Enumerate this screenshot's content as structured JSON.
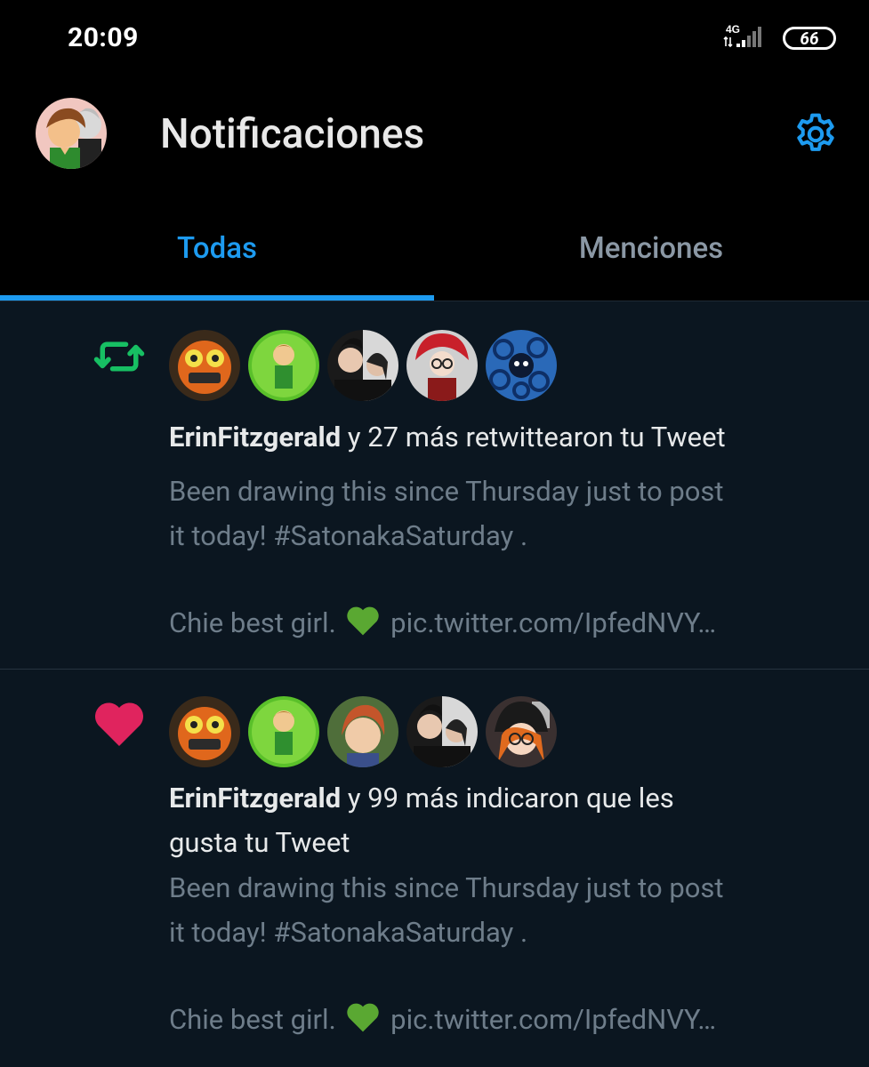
{
  "status_bar": {
    "time": "20:09",
    "network": "4G",
    "battery": "66"
  },
  "header": {
    "title": "Notificaciones",
    "avatar_icon": "profile-avatar",
    "settings_icon": "gear-icon"
  },
  "tabs": [
    {
      "label": "Todas",
      "active": true
    },
    {
      "label": "Menciones",
      "active": false
    }
  ],
  "notifications": [
    {
      "type": "retweet",
      "icon": "retweet-icon",
      "icon_color": "#17bf63",
      "actor": "ErinFitzgerald",
      "action": " y 27 más retwittearon tu Tweet",
      "tweet_line1": "Been drawing this since Thursday just to post",
      "tweet_line2": "it today! #SatonakaSaturday .",
      "tweet_line3_a": "Chie best girl.",
      "tweet_line3_b": "pic.twitter.com/IpfedNVY…"
    },
    {
      "type": "like",
      "icon": "heart-icon",
      "icon_color": "#e0245e",
      "actor": "ErinFitzgerald",
      "action_line1": " y 99 más indicaron que les",
      "action_line2": "gusta tu Tweet",
      "tweet_line1": "Been drawing this since Thursday just to post",
      "tweet_line2": "it today! #SatonakaSaturday .",
      "tweet_line3_a": "Chie best girl.",
      "tweet_line3_b": "pic.twitter.com/IpfedNVY…"
    }
  ],
  "colors": {
    "accent": "#1d9bf0",
    "retweet": "#17bf63",
    "like": "#e0245e",
    "emoji_heart": "#5aa832"
  }
}
